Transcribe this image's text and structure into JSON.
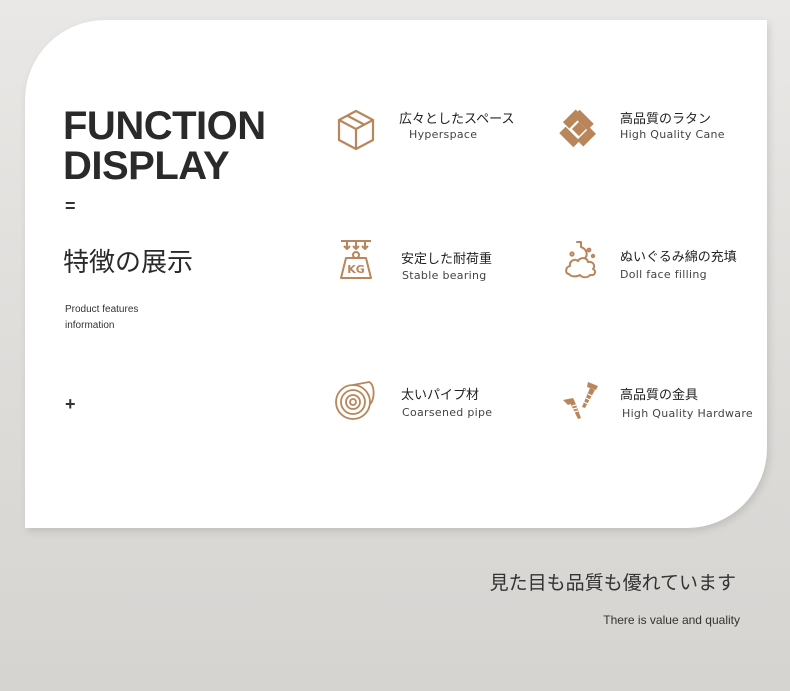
{
  "header": {
    "title_line1": "FUNCTION",
    "title_line2": "DISPLAY",
    "equals_mark": "=",
    "jp_title": "特徴の展示",
    "features_en_line1": "Product features",
    "features_en_line2": "information",
    "plus_mark": "+"
  },
  "features": [
    {
      "jp": "広々としたスペース",
      "en": "Hyperspace",
      "icon": "box-icon"
    },
    {
      "jp": "高品質のラタン",
      "en": "High Quality Cane",
      "icon": "rattan-weave-icon"
    },
    {
      "jp": "安定した耐荷重",
      "en": "Stable bearing",
      "icon": "kg-weight-icon"
    },
    {
      "jp": "ぬいぐるみ綿の充填",
      "en": "Doll face filling",
      "icon": "cotton-filling-icon"
    },
    {
      "jp": "太いパイプ材",
      "en": "Coarsened pipe",
      "icon": "pipe-cross-section-icon"
    },
    {
      "jp": "高品質の金具",
      "en": "High Quality Hardware",
      "icon": "screws-icon"
    }
  ],
  "footer": {
    "jp": "見た目も品質も優れています",
    "en": "There is value and quality"
  },
  "colors": {
    "accent": "#b8865a",
    "background": "#e4e2df",
    "card": "#ffffff",
    "text": "#2a2a2a"
  }
}
